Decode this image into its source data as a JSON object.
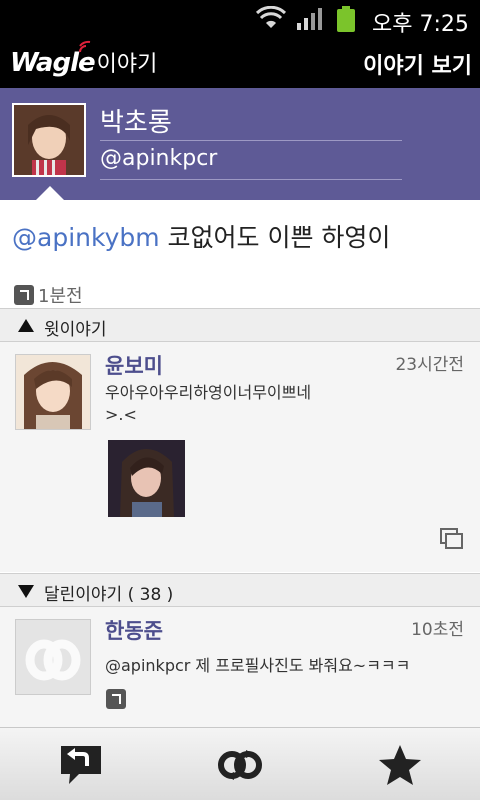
{
  "status_bar": {
    "time": "오후 7:25"
  },
  "app_bar": {
    "brand": "Wagle",
    "brand_sub": "이야기",
    "screen_title": "이야기 보기"
  },
  "profile": {
    "name": "박초롱",
    "handle": "@apinkpcr"
  },
  "post": {
    "mention": "@apinkybm",
    "text": " 코없어도 이쁜 하영이",
    "time": "1분전"
  },
  "sections": {
    "parent": {
      "label": "윗이야기"
    },
    "replies": {
      "label": "달린이야기 ( 38 )"
    }
  },
  "parent_story": {
    "name": "윤보미",
    "time": "23시간전",
    "text_line1": "우아우아우리하영이너무이쁘네",
    "text_line2": ">.<"
  },
  "reply": {
    "name": "한동준",
    "time": "10초전",
    "text": "@apinkpcr 제 프로필사진도 봐줘요~ㅋㅋㅋ"
  },
  "toolbar": {
    "icons": [
      "reply-icon",
      "retweet-icon",
      "favorite-icon"
    ]
  },
  "colors": {
    "profile_bg": "#5e5a96",
    "name_color": "#4d4e8d",
    "mention_color": "#4a72c4"
  }
}
